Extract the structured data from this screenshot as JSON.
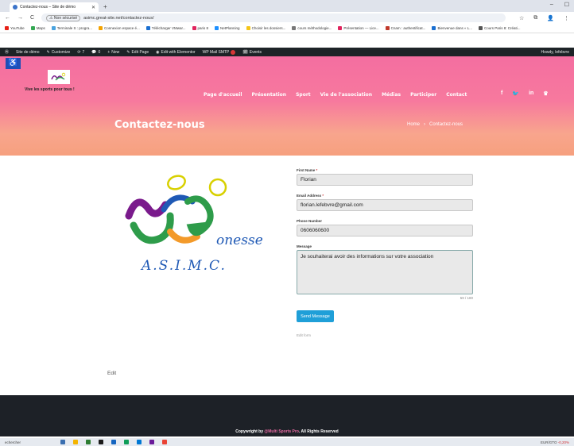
{
  "browser": {
    "tab_title": "Contactez-nous – Site de démo",
    "new_tab": "+",
    "window_controls": [
      "–",
      "☐"
    ],
    "nav": [
      "←",
      "→",
      "C"
    ],
    "security_label": "⚠ Non sécurisé",
    "url": "asimc.great-site.net/contactez-nous/",
    "right_icons": [
      "☆",
      "⧉",
      "👤",
      "⋮"
    ],
    "bookmarks": [
      {
        "label": "YouTube",
        "color": "#e62117"
      },
      {
        "label": "Maps",
        "color": "#34a853"
      },
      {
        "label": "Terminale S : progra...",
        "color": "#4aa3df"
      },
      {
        "label": "Connexion espace é...",
        "color": "#f4a300"
      },
      {
        "label": "Télécharger VMwar...",
        "color": "#1a6fd1"
      },
      {
        "label": "paris 8",
        "color": "#e0245e"
      },
      {
        "label": "NetPlanning",
        "color": "#1e90ff"
      },
      {
        "label": "Choisir les dossiers...",
        "color": "#f5c518"
      },
      {
        "label": "cours méthodologie...",
        "color": "#777777"
      },
      {
        "label": "Présentation — Lice...",
        "color": "#e0245e"
      },
      {
        "label": "Cnam : authentificat...",
        "color": "#c0392b"
      },
      {
        "label": "Bienvenue dans « L...",
        "color": "#1a6fd1"
      },
      {
        "label": "Cours Paris 8: Créati...",
        "color": "#555555"
      }
    ]
  },
  "wp_admin_bar": {
    "items": [
      "Site de démo",
      "Customize",
      "7",
      "0",
      "New",
      "Edit Page",
      "Edit with Elementor",
      "WP Mail SMTP",
      "Events"
    ],
    "howdy": "Howdy, lefebvre"
  },
  "header": {
    "tagline": "Vive les sports pour tous !",
    "nav": [
      "Page d'accueil",
      "Présentation",
      "Sport",
      "Vie de l'association",
      "Médias",
      "Participer",
      "Contact"
    ],
    "social": [
      "f",
      "🐦",
      "in",
      "♛"
    ],
    "page_title": "Contactez-nous",
    "breadcrumb": {
      "home": "Home",
      "sep": "›",
      "current": "Contactez-nous"
    }
  },
  "logo": {
    "text1": "onesse",
    "text2": "A.S.I.M.C.",
    "colors": {
      "yellow": "#d8d000",
      "purple": "#7a1a8c",
      "green": "#2e9c4a",
      "orange": "#f39a2a",
      "blue": "#1f59b5"
    }
  },
  "form": {
    "first_name": {
      "label": "First Name",
      "required": "*",
      "value": "Florian"
    },
    "email": {
      "label": "Email Address",
      "required": "*",
      "value": "florian.lefebvre@gmail.com"
    },
    "phone": {
      "label": "Phone Number",
      "value": "0606060600"
    },
    "message": {
      "label": "Message",
      "value": "Je souhaiterai avoir des informations sur votre association",
      "counter": "59 / 180"
    },
    "send": "Send Message",
    "edit_form": "Edit form"
  },
  "edit_link": "Edit",
  "footer": {
    "copy_prefix": "Copywright by ",
    "copy_link": "@Multi Sports Pro",
    "copy_suffix": ". All Rights Reserved"
  },
  "taskbar": {
    "search": "echercher",
    "ticker": "EUR/GTO",
    "ticker_change": "-0,20%",
    "icon_colors": [
      "#3a6fb0",
      "#f4b400",
      "#2e7d32",
      "#1a1a1a",
      "#1565c0",
      "#0f9d58",
      "#0078d4",
      "#6a1b9a",
      "#ea4335"
    ]
  }
}
